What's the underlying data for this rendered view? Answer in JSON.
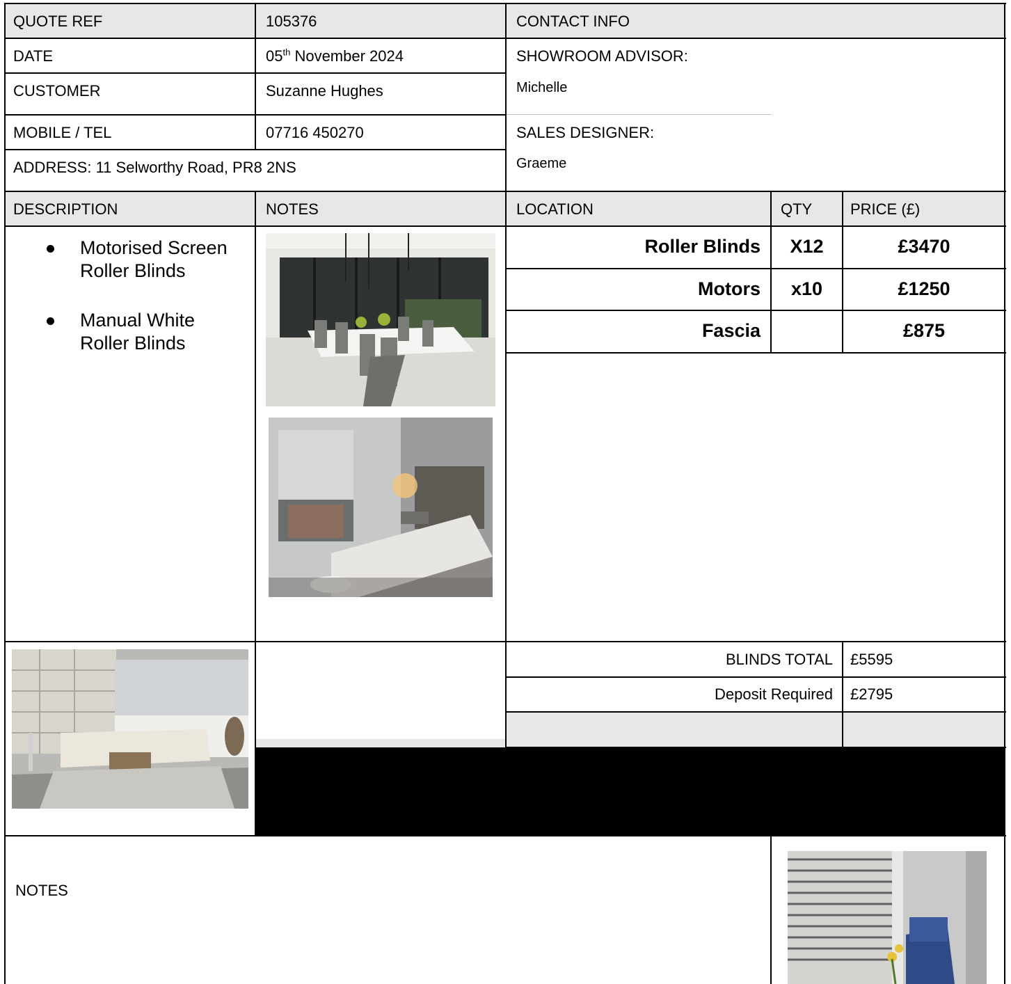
{
  "header": {
    "quote_ref_label": "QUOTE REF",
    "quote_ref_value": "105376",
    "contact_info_label": "CONTACT INFO",
    "date_label": "DATE",
    "date_day": "05",
    "date_suffix": "th",
    "date_rest": " November 2024",
    "customer_label": "CUSTOMER",
    "customer_value": "Suzanne Hughes",
    "mobile_label": "MOBILE / TEL",
    "mobile_value": "07716 450270",
    "address": "ADDRESS: 11 Selworthy Road, PR8 2NS",
    "showroom_advisor_label": "SHOWROOM ADVISOR:",
    "showroom_advisor_value": "Michelle",
    "sales_designer_label": "SALES DESIGNER:",
    "sales_designer_value": "Graeme"
  },
  "columns": {
    "description": "DESCRIPTION",
    "notes": "NOTES",
    "location": "LOCATION",
    "qty": "QTY",
    "price": "PRICE (£)"
  },
  "description_items": [
    {
      "line1": "Motorised Screen",
      "line2": "Roller Blinds"
    },
    {
      "line1": "Manual White",
      "line2": "Roller Blinds"
    }
  ],
  "line_items": [
    {
      "location": "Roller Blinds",
      "qty": "X12",
      "price": "£3470"
    },
    {
      "location": "Motors",
      "qty": "x10",
      "price": "£1250"
    },
    {
      "location": "Fascia",
      "qty": "",
      "price": "£875"
    }
  ],
  "totals": {
    "blinds_total_label": "BLINDS TOTAL",
    "blinds_total_value": "£5595",
    "deposit_label": "Deposit Required",
    "deposit_value": "£2795"
  },
  "footer": {
    "notes_label": "NOTES"
  },
  "images": {
    "dining": "dining-room-screen-blinds-photo",
    "bedroom": "bedroom-roller-blind-photo",
    "lounge": "lounge-roller-blinds-photo",
    "venetian": "venetian-blinds-chair-photo"
  }
}
